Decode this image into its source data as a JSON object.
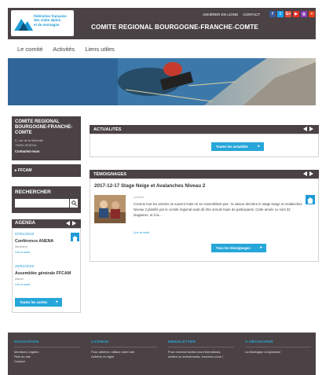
{
  "header": {
    "logo_text": "fédération française\ndes clubs alpins\net de montagne",
    "site_title": "COMITE REGIONAL BOURGOGNE-FRANCHE-COMTE",
    "links": [
      "ADHÉRER EN LIGNE",
      "CONTACT"
    ],
    "social": [
      {
        "name": "facebook-icon",
        "glyph": "f",
        "color": "#3b5998"
      },
      {
        "name": "twitter-icon",
        "glyph": "t",
        "color": "#1da1f2"
      },
      {
        "name": "google-plus-icon",
        "glyph": "G+",
        "color": "#dd4b39"
      },
      {
        "name": "youtube-icon",
        "glyph": "▶",
        "color": "#e52d27"
      },
      {
        "name": "instagram-icon",
        "glyph": "◎",
        "color": "#8a3ab9"
      },
      {
        "name": "add-icon",
        "glyph": "+",
        "color": "#e2421e"
      }
    ]
  },
  "nav": [
    "Le comité",
    "Activités",
    "Liens utiles"
  ],
  "sidebar": {
    "org_title": "COMITE REGIONAL BOURGOGNE-FRANCHE-COMTE",
    "address": "5, rue de la Michelle\n70000 VESOUL",
    "contact": "Contactez-nous",
    "ffcam": "FFCAM",
    "search_title": "RECHERCHER",
    "search_placeholder": ""
  },
  "agenda": {
    "title": "AGENDA",
    "events": [
      {
        "date": "07/01/2018",
        "title": "Conférence ANENA",
        "location": "Montbéry",
        "more": "Lire la suite"
      },
      {
        "date": "20/01/2018",
        "title": "Assemblée générale FFCAM",
        "location": "Mâcon",
        "more": "Lire la suite"
      }
    ],
    "button": "Toutes les sorties"
  },
  "actualites": {
    "title": "ACTUALITÉS",
    "button": "Toutes les actualités"
  },
  "temoignages": {
    "title": "TÉMOIGNAGES",
    "item_title": "2017-12-17 Stage Neige et Avalanches Niveau 2",
    "author": "Lecteur",
    "text": "Comme tout les années se suivent mais ne se ressemblent pas : la saison dernière le stage Neige et Avalanches Niveau 2 planifié par le comité régional avait dû être annulé faute de participants. Cette année ce sont 32 stagiaires, et à la...",
    "more": "Lire la suite",
    "button": "Tous les témoignages"
  },
  "footer": {
    "columns": [
      {
        "title": "NAVIGATION",
        "text": "Mentions Légales\nPlan du site\nContact"
      },
      {
        "title": "LICENCE",
        "text": "Pour adhérer, utilisez notre site\nAdhérer en ligne"
      },
      {
        "title": "NEWSLETTER",
        "text": "Pour recevoir toutes nos informations,\nsorties ou événements, inscrivez-vous !"
      },
      {
        "title": "À DÉCOUVRIR",
        "text": "La Montagne & Alpinisme"
      }
    ]
  }
}
